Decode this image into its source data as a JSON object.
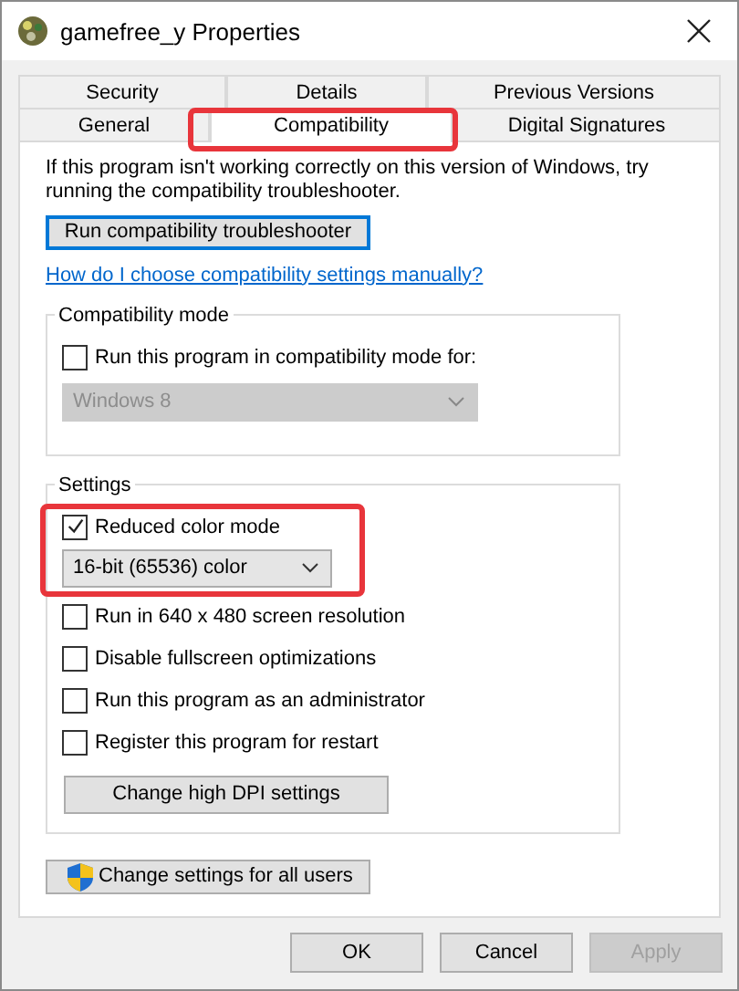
{
  "window": {
    "title": "gamefree_y Properties"
  },
  "tab_rows": [
    [
      {
        "label": "Security",
        "selected": false,
        "highlighted": false
      },
      {
        "label": "Details",
        "selected": false,
        "highlighted": false
      },
      {
        "label": "Previous Versions",
        "selected": false,
        "highlighted": false
      }
    ],
    [
      {
        "label": "General",
        "selected": false,
        "highlighted": false
      },
      {
        "label": "Compatibility",
        "selected": true,
        "highlighted": true
      },
      {
        "label": "Digital Signatures",
        "selected": false,
        "highlighted": false
      }
    ]
  ],
  "intro": "If this program isn't working correctly on this version of Windows, try running the compatibility troubleshooter.",
  "troubleshoot_button": "Run compatibility troubleshooter",
  "help_link": "How do I choose compatibility settings manually?",
  "compat_mode": {
    "title": "Compatibility mode",
    "label": "Run this program in compatibility mode for:",
    "checked": false,
    "select": "Windows 8",
    "disabled": true
  },
  "settings": {
    "title": "Settings",
    "reduced_color": {
      "label": "Reduced color mode",
      "checked": true,
      "select": "16-bit (65536) color",
      "highlighted": true
    },
    "options": [
      {
        "label": "Run in 640 x 480 screen resolution",
        "checked": false
      },
      {
        "label": "Disable fullscreen optimizations",
        "checked": false
      },
      {
        "label": "Run this program as an administrator",
        "checked": false
      },
      {
        "label": "Register this program for restart",
        "checked": false
      }
    ],
    "dpi_button": "Change high DPI settings"
  },
  "all_users_button": "Change settings for all users",
  "buttons": [
    {
      "label": "OK",
      "disabled": false
    },
    {
      "label": "Cancel",
      "disabled": false
    },
    {
      "label": "Apply",
      "disabled": true
    }
  ]
}
